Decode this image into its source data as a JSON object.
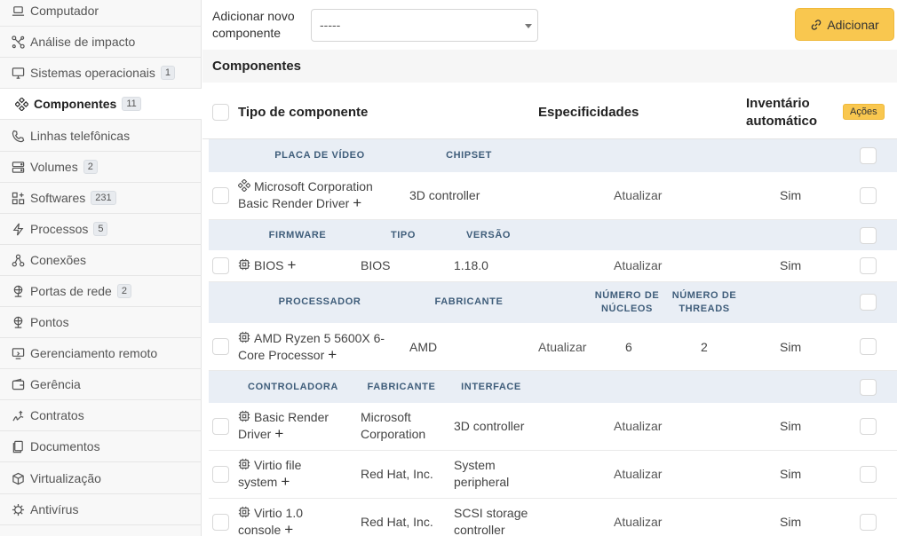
{
  "sidebar": {
    "items": [
      {
        "label": "Computador",
        "icon": "laptop-icon"
      },
      {
        "label": "Análise de impacto",
        "icon": "network-icon"
      },
      {
        "label": "Sistemas operacionais",
        "icon": "desktop-icon",
        "badge": "1"
      },
      {
        "label": "Componentes",
        "icon": "components-icon",
        "badge": "11",
        "active": true
      },
      {
        "label": "Linhas telefônicas",
        "icon": "phone-icon"
      },
      {
        "label": "Volumes",
        "icon": "drive-icon",
        "badge": "2"
      },
      {
        "label": "Softwares",
        "icon": "apps-icon",
        "badge": "231"
      },
      {
        "label": "Processos",
        "icon": "bolt-icon",
        "badge": "5"
      },
      {
        "label": "Conexões",
        "icon": "connections-icon"
      },
      {
        "label": "Portas de rede",
        "icon": "globe-network-icon",
        "badge": "2"
      },
      {
        "label": "Pontos",
        "icon": "socket-icon"
      },
      {
        "label": "Gerenciamento remoto",
        "icon": "remote-icon"
      },
      {
        "label": "Gerência",
        "icon": "wallet-icon"
      },
      {
        "label": "Contratos",
        "icon": "contract-icon"
      },
      {
        "label": "Documentos",
        "icon": "documents-icon"
      },
      {
        "label": "Virtualização",
        "icon": "cube-icon"
      },
      {
        "label": "Antivírus",
        "icon": "virus-icon"
      }
    ]
  },
  "toolbar": {
    "add_label": "Adicionar novo componente",
    "select_value": "-----",
    "add_button": "Adicionar"
  },
  "section_title": "Componentes",
  "table_header": {
    "type": "Tipo de componente",
    "specs": "Especificidades",
    "inventory": "Inventário automático",
    "actions": "Ações"
  },
  "groups": [
    {
      "headers": [
        "PLACA DE VÍDEO",
        "CHIPSET"
      ],
      "rows": [
        {
          "name": "Microsoft Corporation Basic Render Driver",
          "cols": [
            "3D controller"
          ],
          "update": "Atualizar",
          "auto": "Sim"
        }
      ]
    },
    {
      "headers": [
        "FIRMWARE",
        "TIPO",
        "VERSÃO"
      ],
      "rows": [
        {
          "name": "BIOS",
          "cols": [
            "BIOS",
            "1.18.0"
          ],
          "update": "Atualizar",
          "auto": "Sim"
        }
      ]
    },
    {
      "headers": [
        "PROCESSADOR",
        "FABRICANTE",
        "NÚMERO DE NÚCLEOS",
        "NÚMERO DE THREADS"
      ],
      "rows": [
        {
          "name": "AMD Ryzen 5 5600X 6-Core Processor",
          "cols": [
            "AMD",
            "6",
            "2"
          ],
          "update": "Atualizar",
          "auto": "Sim"
        }
      ]
    },
    {
      "headers": [
        "CONTROLADORA",
        "FABRICANTE",
        "INTERFACE"
      ],
      "rows": [
        {
          "name": "Basic Render Driver",
          "cols": [
            "Microsoft Corporation",
            "3D controller"
          ],
          "update": "Atualizar",
          "auto": "Sim"
        },
        {
          "name": "Virtio file system",
          "cols": [
            "Red Hat, Inc.",
            "System peripheral"
          ],
          "update": "Atualizar",
          "auto": "Sim"
        },
        {
          "name": "Virtio 1.0 console",
          "cols": [
            "Red Hat, Inc.",
            "SCSI storage controller"
          ],
          "update": "Atualizar",
          "auto": "Sim"
        }
      ]
    }
  ]
}
